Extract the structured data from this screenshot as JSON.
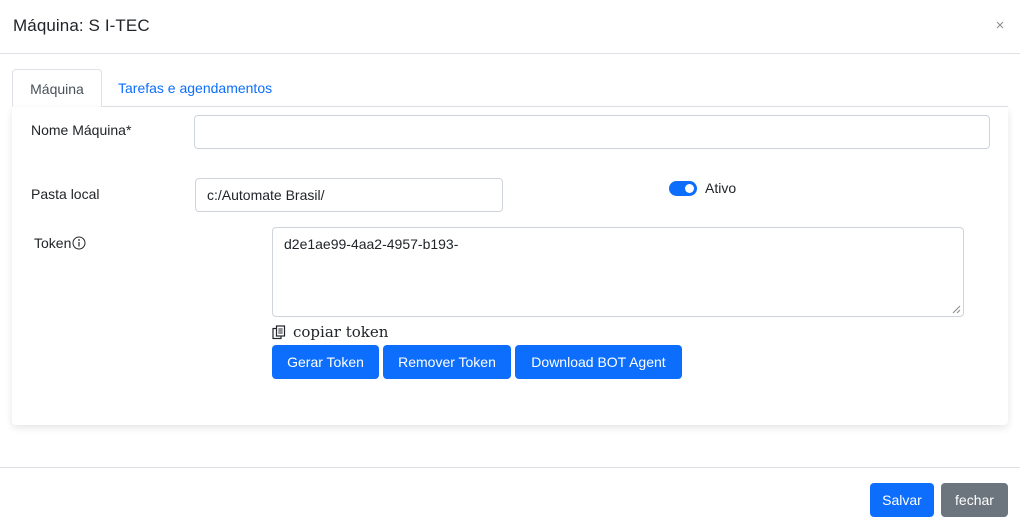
{
  "modal": {
    "title": "Máquina: S      I-TEC",
    "close_glyph": "×"
  },
  "tabs": [
    {
      "label": "Máquina",
      "active": true
    },
    {
      "label": "Tarefas e agendamentos",
      "active": false
    }
  ],
  "form": {
    "name_label": "Nome Máquina*",
    "name_value": "",
    "folder_label": "Pasta local",
    "folder_value": "c:/Automate Brasil/",
    "active_label": "Ativo",
    "active_on": true,
    "token_label": "Token",
    "token_value": "d2e1ae99-4aa2-4957-b193-",
    "copy_label": "copiar token"
  },
  "buttons": {
    "generate": "Gerar Token",
    "remove": "Remover Token",
    "download": "Download BOT Agent"
  },
  "footer": {
    "save": "Salvar",
    "close": "fechar"
  },
  "colors": {
    "primary": "#0d6efd",
    "secondary": "#6c757d",
    "border": "#dee2e6"
  },
  "icons": {
    "close": "close-icon",
    "info": "info-circle-icon",
    "copy": "copy-icon",
    "toggle": "toggle-switch"
  }
}
